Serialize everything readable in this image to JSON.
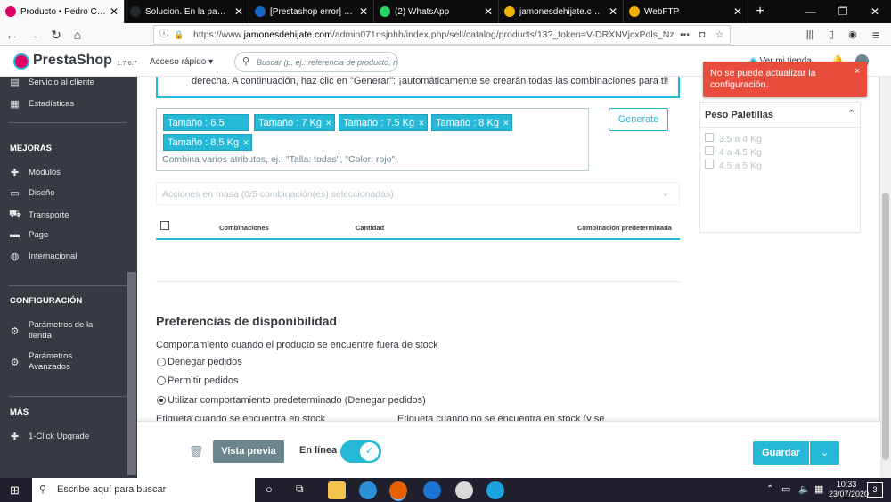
{
  "browser": {
    "tabs": [
      {
        "label": "Producto • Pedro Castañ",
        "color": "#df0067",
        "active": true
      },
      {
        "label": "Solucion. En la pantalla d",
        "color": "#24292e",
        "active": false
      },
      {
        "label": "[Prestashop error] Soluci",
        "color": "#1565c0",
        "active": false
      },
      {
        "label": "(2) WhatsApp",
        "color": "#25d366",
        "active": false
      },
      {
        "label": "jamonesdehijate.com - C",
        "color": "#f0b400",
        "active": false
      },
      {
        "label": "WebFTP",
        "color": "#f0b400",
        "active": false
      }
    ],
    "new_tab": "+",
    "url_prefix": "https://www.",
    "url_domain": "jamonesdehijate.com",
    "url_rest": "/admin071nsjnhh/index.php/sell/catalog/products/13?_token=V-DRXNVjcxPdls_NzCy_",
    "url_more": "•••"
  },
  "ps_header": {
    "logo": "PrestaShop",
    "version": "1.7.6.7",
    "quick_access": "Acceso rápido",
    "search_placeholder": "Buscar (p. ej.: referencia de producto, n",
    "view_store": "Ver mi tienda"
  },
  "sidebar": {
    "top_items": [
      {
        "label": "Servicio al cliente",
        "icon": "chat-icon"
      },
      {
        "label": "Estadísticas",
        "icon": "stats-icon"
      }
    ],
    "sections": [
      {
        "title": "MEJORAS",
        "items": [
          "Módulos",
          "Diseño",
          "Transporte",
          "Pago",
          "Internacional"
        ]
      },
      {
        "title": "CONFIGURACIÓN",
        "items": [
          "Parámetros de la tienda",
          "Parámetros Avanzados"
        ]
      },
      {
        "title": "MÁS",
        "items": [
          "1-Click Upgrade"
        ]
      }
    ]
  },
  "main": {
    "info_text": "derecha. A continuación, haz clic en \"Generar\": ¡automáticamente se crearán todas las combinaciones para ti!",
    "chips": [
      "Tamaño : 6.5 Kg",
      "Tamaño : 7 Kg",
      "Tamaño : 7.5 Kg",
      "Tamaño : 8 Kg",
      "Tamaño : 8,5 Kg"
    ],
    "chip_placeholder": "Combina varios atributos, ej.: \"Talla: todas\", \"Color: rojo\".",
    "generate_label": "Generate",
    "bulk_actions": "Acciones en masa (0/5 combinación(es) seleccionadas)",
    "table_headers": [
      "Combinaciones",
      "Cantidad",
      "Combinación predeterminada"
    ],
    "availability_title": "Preferencias de disponibilidad",
    "stock_behavior_label": "Comportamiento cuando el producto se encuentre fuera de stock",
    "options": [
      "Denegar pedidos",
      "Permitir pedidos",
      "Utilizar comportamiento predeterminado (Denegar pedidos)"
    ],
    "selected_option": 2,
    "label_in_stock": "Etiqueta cuando se encuentra en stock",
    "label_out_stock": "Etiqueta cuando no se encuentra en stock (y se",
    "error_toast": "No se puede actualizar la configuración.",
    "toast_close": "×",
    "weight_panel_title": "Peso Paletillas",
    "weight_options": [
      "3.5 a 4 Kg",
      "4 a 4.5 Kg",
      "4.5 a 5 Kg"
    ]
  },
  "bottom_bar": {
    "preview": "Vista previa",
    "online": "En línea",
    "save": "Guardar"
  },
  "taskbar": {
    "search_placeholder": "Escribe aquí para buscar",
    "time": "10:33",
    "date": "23/07/2020",
    "notifications": "3"
  },
  "colors": {
    "accent": "#25b9d7",
    "sidebar": "#363a41",
    "error": "#e74c3c",
    "preview_button": "#6c868e"
  }
}
